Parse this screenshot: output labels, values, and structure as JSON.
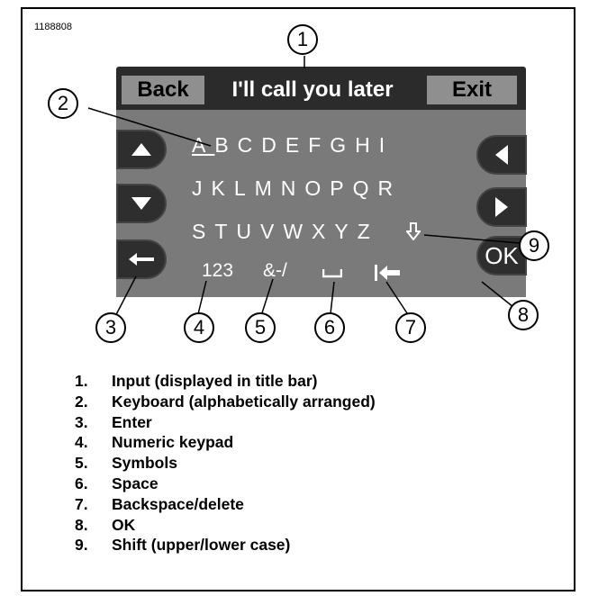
{
  "figure_id": "1188808",
  "screen": {
    "back_label": "Back",
    "title_input": "I'll call you later",
    "exit_label": "Exit",
    "rows": [
      "ABCDEFGHI",
      "JKLMNOPQR",
      "STUVWXYZ"
    ],
    "numeric_label": "123",
    "symbols_label": "&-/",
    "ok_label": "OK",
    "icons": {
      "up": "up-arrow",
      "down": "down-arrow",
      "left": "left-arrow",
      "right": "right-arrow",
      "enter": "enter-arrow",
      "shift": "shift-arrow",
      "space": "space-bar",
      "backspace": "backspace-arrow"
    },
    "colors": {
      "title_bar": "#2b2b2b",
      "keyboard": "#7a7a7a",
      "title_button": "#8f8f8f",
      "side_key": "#2e2e2e"
    }
  },
  "callouts": [
    "1",
    "2",
    "3",
    "4",
    "5",
    "6",
    "7",
    "8",
    "9"
  ],
  "legend": [
    {
      "num": "1.",
      "text": "Input (displayed in title bar)"
    },
    {
      "num": "2.",
      "text": "Keyboard (alphabetically arranged)"
    },
    {
      "num": "3.",
      "text": "Enter"
    },
    {
      "num": "4.",
      "text": "Numeric keypad"
    },
    {
      "num": "5.",
      "text": "Symbols"
    },
    {
      "num": "6.",
      "text": "Space"
    },
    {
      "num": "7.",
      "text": "Backspace/delete"
    },
    {
      "num": "8.",
      "text": "OK"
    },
    {
      "num": "9.",
      "text": "Shift (upper/lower case)"
    }
  ]
}
